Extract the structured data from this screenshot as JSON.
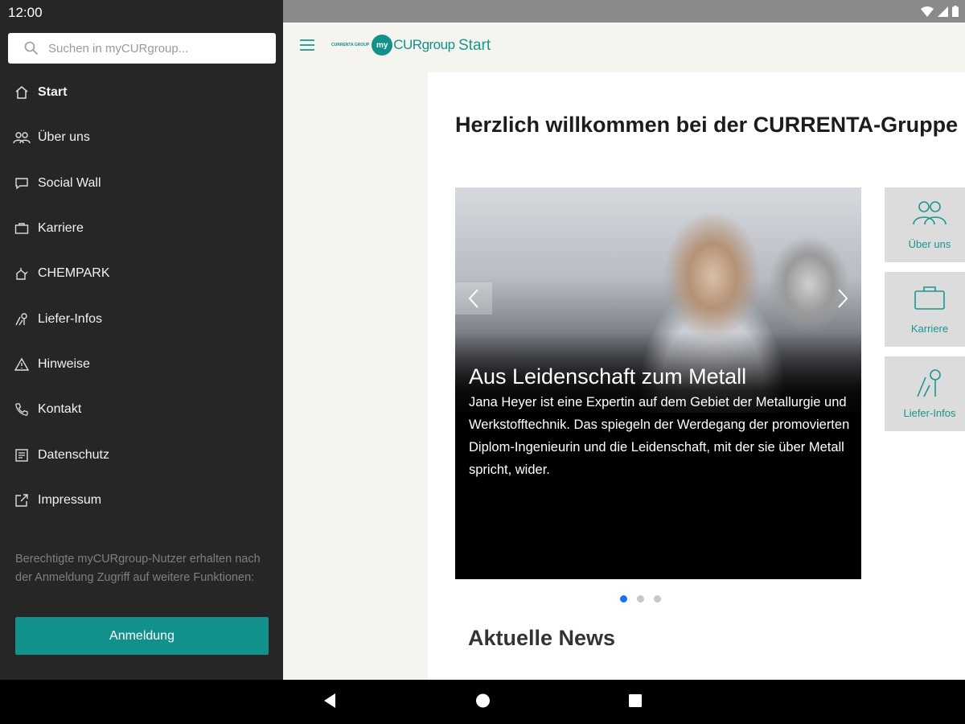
{
  "status": {
    "time": "12:00"
  },
  "search": {
    "placeholder": "Suchen in myCURgroup..."
  },
  "drawer": {
    "items": [
      {
        "label": "Start",
        "icon": "home-icon"
      },
      {
        "label": "Über uns",
        "icon": "people-icon"
      },
      {
        "label": "Social Wall",
        "icon": "chat-icon"
      },
      {
        "label": "Karriere",
        "icon": "briefcase-icon"
      },
      {
        "label": "CHEMPARK",
        "icon": "chempark-icon"
      },
      {
        "label": "Liefer-Infos",
        "icon": "delivery-icon"
      },
      {
        "label": "Hinweise",
        "icon": "warning-icon"
      },
      {
        "label": "Kontakt",
        "icon": "phone-icon"
      },
      {
        "label": "Datenschutz",
        "icon": "document-icon"
      },
      {
        "label": "Impressum",
        "icon": "external-link-icon"
      }
    ],
    "note": "Berechtigte myCURgroup-Nutzer erhalten nach der Anmeldung Zugriff auf weitere Funktionen:",
    "login_label": "Anmeldung"
  },
  "appbar": {
    "title": "Start",
    "logo_small": "CURRENTA GROUP",
    "logo_badge": "my",
    "logo_word": "CURgroup"
  },
  "main": {
    "welcome": "Herzlich willkommen bei der CURRENTA-Gruppe",
    "slide": {
      "title": "Aus Leidenschaft zum Metall",
      "text": "Jana Heyer ist eine Expertin auf dem Gebiet der Metallurgie und Werkstofftechnik. Das spiegeln der Werdegang der promovierten Diplom-Ingenieurin und die Leidenschaft, mit der sie über Metall spricht, wider."
    },
    "news_title": "Aktuelle News",
    "tiles": [
      {
        "label": "Über uns"
      },
      {
        "label": "Karriere"
      },
      {
        "label": "Liefer-Infos"
      }
    ]
  },
  "colors": {
    "accent": "#12908c",
    "drawer_bg": "#262626",
    "dot_active": "#1a73e8"
  }
}
